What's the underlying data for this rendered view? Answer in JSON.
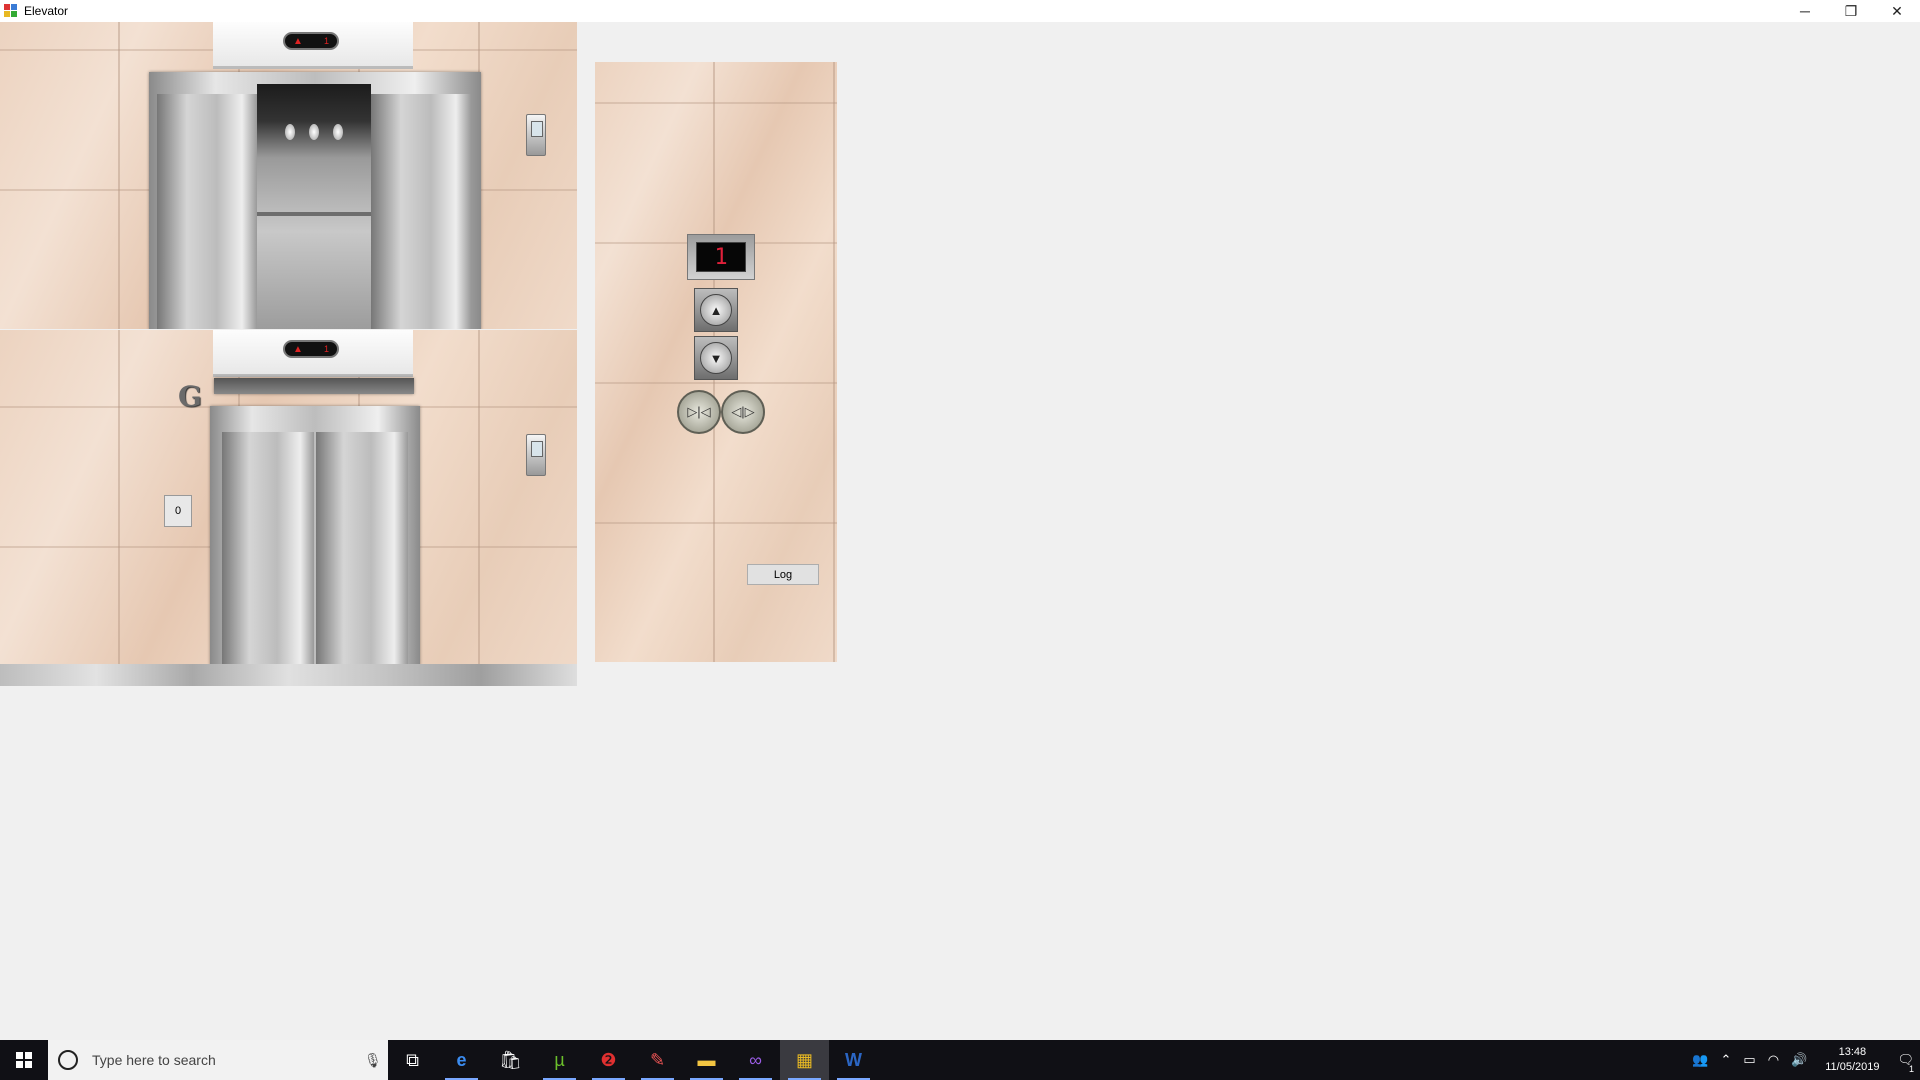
{
  "window": {
    "title": "Elevator",
    "controls": {
      "minimize": "─",
      "restore": "❐",
      "close": "✕"
    }
  },
  "floors": {
    "top": {
      "indicator_arrow": "▲",
      "indicator_value": "1"
    },
    "bottom": {
      "indicator_arrow": "▲",
      "indicator_value": "1",
      "floor_letter": "G",
      "floor_button_value": "0"
    }
  },
  "control_panel": {
    "display_value": "1",
    "up_icon": "▲",
    "down_icon": "▼",
    "open_icon": "▷|◁",
    "close_icon": "◁|▷",
    "log_label": "Log"
  },
  "taskbar": {
    "search_placeholder": "Type here to search",
    "clock_time": "13:48",
    "clock_date": "11/05/2019",
    "notification_count": "1",
    "apps": [
      "task-view",
      "edge",
      "store",
      "utorrent",
      "app-red",
      "app-paint",
      "file-explorer",
      "visual-studio",
      "elevator-app",
      "word"
    ]
  },
  "colors": {
    "wall": "#f0dac9",
    "display_digit": "#e0203a",
    "taskbar": "#101015"
  }
}
